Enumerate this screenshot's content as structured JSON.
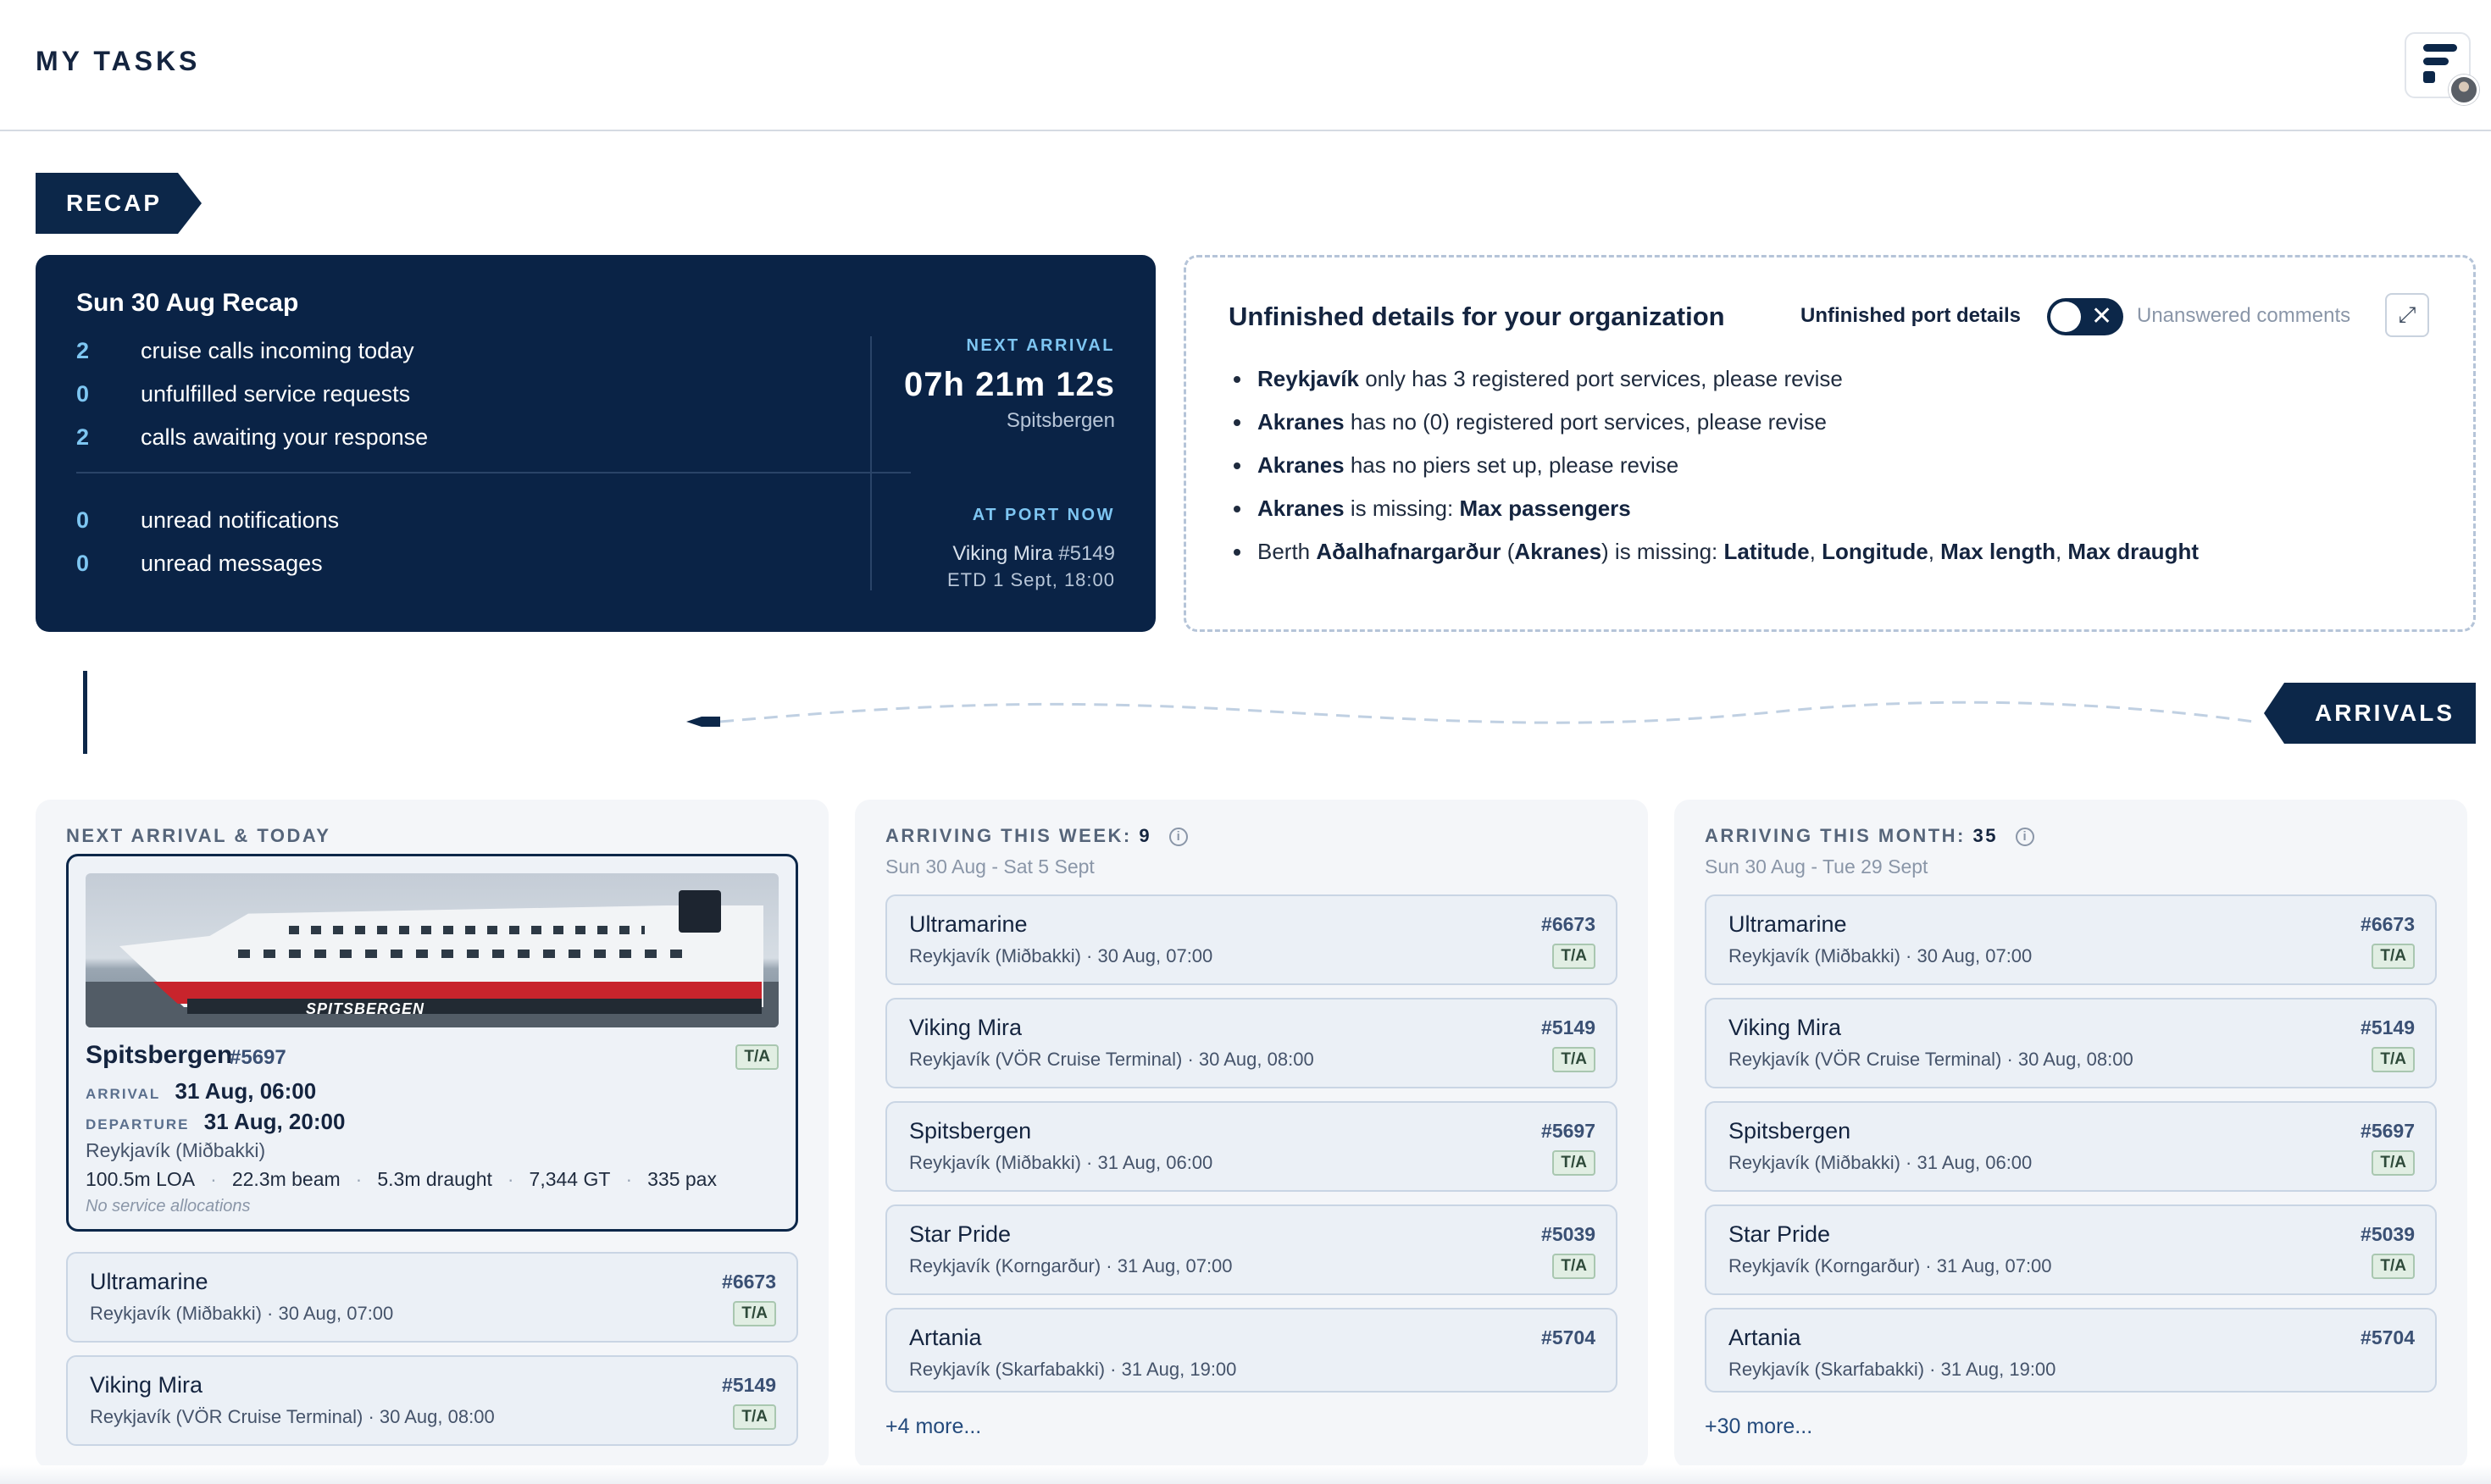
{
  "header": {
    "title": "MY TASKS"
  },
  "recap": {
    "ribbon_label": "RECAP",
    "title": "Sun 30 Aug Recap",
    "stats": [
      {
        "num": "2",
        "label": "cruise calls incoming today"
      },
      {
        "num": "0",
        "label": "unfulfilled service requests"
      },
      {
        "num": "2",
        "label": "calls awaiting your response"
      },
      {
        "num": "0",
        "label": "unread notifications"
      },
      {
        "num": "0",
        "label": "unread messages"
      }
    ],
    "next_arrival": {
      "kicker": "NEXT ARRIVAL",
      "countdown": "07h 21m 12s",
      "ship": "Spitsbergen"
    },
    "at_port": {
      "kicker": "AT PORT NOW",
      "ship_name": "Viking Mira",
      "ship_id": "#5149",
      "etd": "ETD 1 Sept, 18:00"
    }
  },
  "details": {
    "title": "Unfinished details for your organization",
    "toggle_label": "Unfinished port details",
    "toggle_alt_label": "Unanswered comments",
    "items": [
      {
        "parts": [
          {
            "b": "Reykjavík"
          },
          {
            "t": " only has 3 registered port services, please revise"
          }
        ]
      },
      {
        "parts": [
          {
            "b": "Akranes"
          },
          {
            "t": " has no (0) registered port services, please revise"
          }
        ]
      },
      {
        "parts": [
          {
            "b": "Akranes"
          },
          {
            "t": " has no piers set up, please revise"
          }
        ]
      },
      {
        "parts": [
          {
            "b": "Akranes"
          },
          {
            "t": " is missing: "
          },
          {
            "b": "Max passengers"
          }
        ]
      },
      {
        "parts": [
          {
            "t": "Berth "
          },
          {
            "b": "Aðalhafnargarður"
          },
          {
            "t": " ("
          },
          {
            "b": "Akranes"
          },
          {
            "t": ") is missing: "
          },
          {
            "b": "Latitude"
          },
          {
            "t": ", "
          },
          {
            "b": "Longitude"
          },
          {
            "t": ", "
          },
          {
            "b": "Max length"
          },
          {
            "t": ", "
          },
          {
            "b": "Max draught"
          }
        ]
      }
    ]
  },
  "arrivals": {
    "ribbon_label": "ARRIVALS"
  },
  "today_col": {
    "title": "NEXT ARRIVAL & TODAY",
    "featured": {
      "image_caption": "SPITSBERGEN",
      "name": "Spitsbergen",
      "id": "#5697",
      "badge": "T/A",
      "arrival_tag": "ARRIVAL",
      "arrival": "31 Aug, 06:00",
      "departure_tag": "DEPARTURE",
      "departure": "31 Aug, 20:00",
      "port": "Reykjavík (Miðbakki)",
      "specs": [
        "100.5m LOA",
        "22.3m beam",
        "5.3m draught",
        "7,344 GT",
        "335 pax"
      ],
      "note": "No service allocations"
    },
    "calls": [
      {
        "name": "Ultramarine",
        "sub": "Reykjavík (Miðbakki) · 30 Aug, 07:00",
        "id": "#6673",
        "badge": "T/A"
      },
      {
        "name": "Viking Mira",
        "sub": "Reykjavík (VÖR Cruise Terminal) · 30 Aug, 08:00",
        "id": "#5149",
        "badge": "T/A"
      }
    ]
  },
  "week_col": {
    "title": "ARRIVING THIS WEEK:",
    "count": "9",
    "range": "Sun 30 Aug - Sat 5 Sept",
    "calls": [
      {
        "name": "Ultramarine",
        "sub": "Reykjavík (Miðbakki) · 30 Aug, 07:00",
        "id": "#6673",
        "badge": "T/A"
      },
      {
        "name": "Viking Mira",
        "sub": "Reykjavík (VÖR Cruise Terminal) · 30 Aug, 08:00",
        "id": "#5149",
        "badge": "T/A"
      },
      {
        "name": "Spitsbergen",
        "sub": "Reykjavík (Miðbakki) · 31 Aug, 06:00",
        "id": "#5697",
        "badge": "T/A"
      },
      {
        "name": "Star Pride",
        "sub": "Reykjavík (Korngarður) · 31 Aug, 07:00",
        "id": "#5039",
        "badge": "T/A"
      },
      {
        "name": "Artania",
        "sub": "Reykjavík (Skarfabakki) · 31 Aug, 19:00",
        "id": "#5704",
        "badge": ""
      }
    ],
    "more": "+4 more..."
  },
  "month_col": {
    "title": "ARRIVING THIS MONTH:",
    "count": "35",
    "range": "Sun 30 Aug - Tue 29 Sept",
    "calls": [
      {
        "name": "Ultramarine",
        "sub": "Reykjavík (Miðbakki) · 30 Aug, 07:00",
        "id": "#6673",
        "badge": "T/A"
      },
      {
        "name": "Viking Mira",
        "sub": "Reykjavík (VÖR Cruise Terminal) · 30 Aug, 08:00",
        "id": "#5149",
        "badge": "T/A"
      },
      {
        "name": "Spitsbergen",
        "sub": "Reykjavík (Miðbakki) · 31 Aug, 06:00",
        "id": "#5697",
        "badge": "T/A"
      },
      {
        "name": "Star Pride",
        "sub": "Reykjavík (Korngarður) · 31 Aug, 07:00",
        "id": "#5039",
        "badge": "T/A"
      },
      {
        "name": "Artania",
        "sub": "Reykjavík (Skarfabakki) · 31 Aug, 19:00",
        "id": "#5704",
        "badge": ""
      }
    ],
    "more": "+30 more..."
  },
  "icons": {
    "menu": "menu-logo-icon",
    "expand": "expand-icon",
    "info": "info-icon",
    "toggle_off": "close-icon"
  },
  "colors": {
    "navy": "#0c2749",
    "accent_blue": "#7ec6f2",
    "badge_green": "#e1eee3"
  }
}
